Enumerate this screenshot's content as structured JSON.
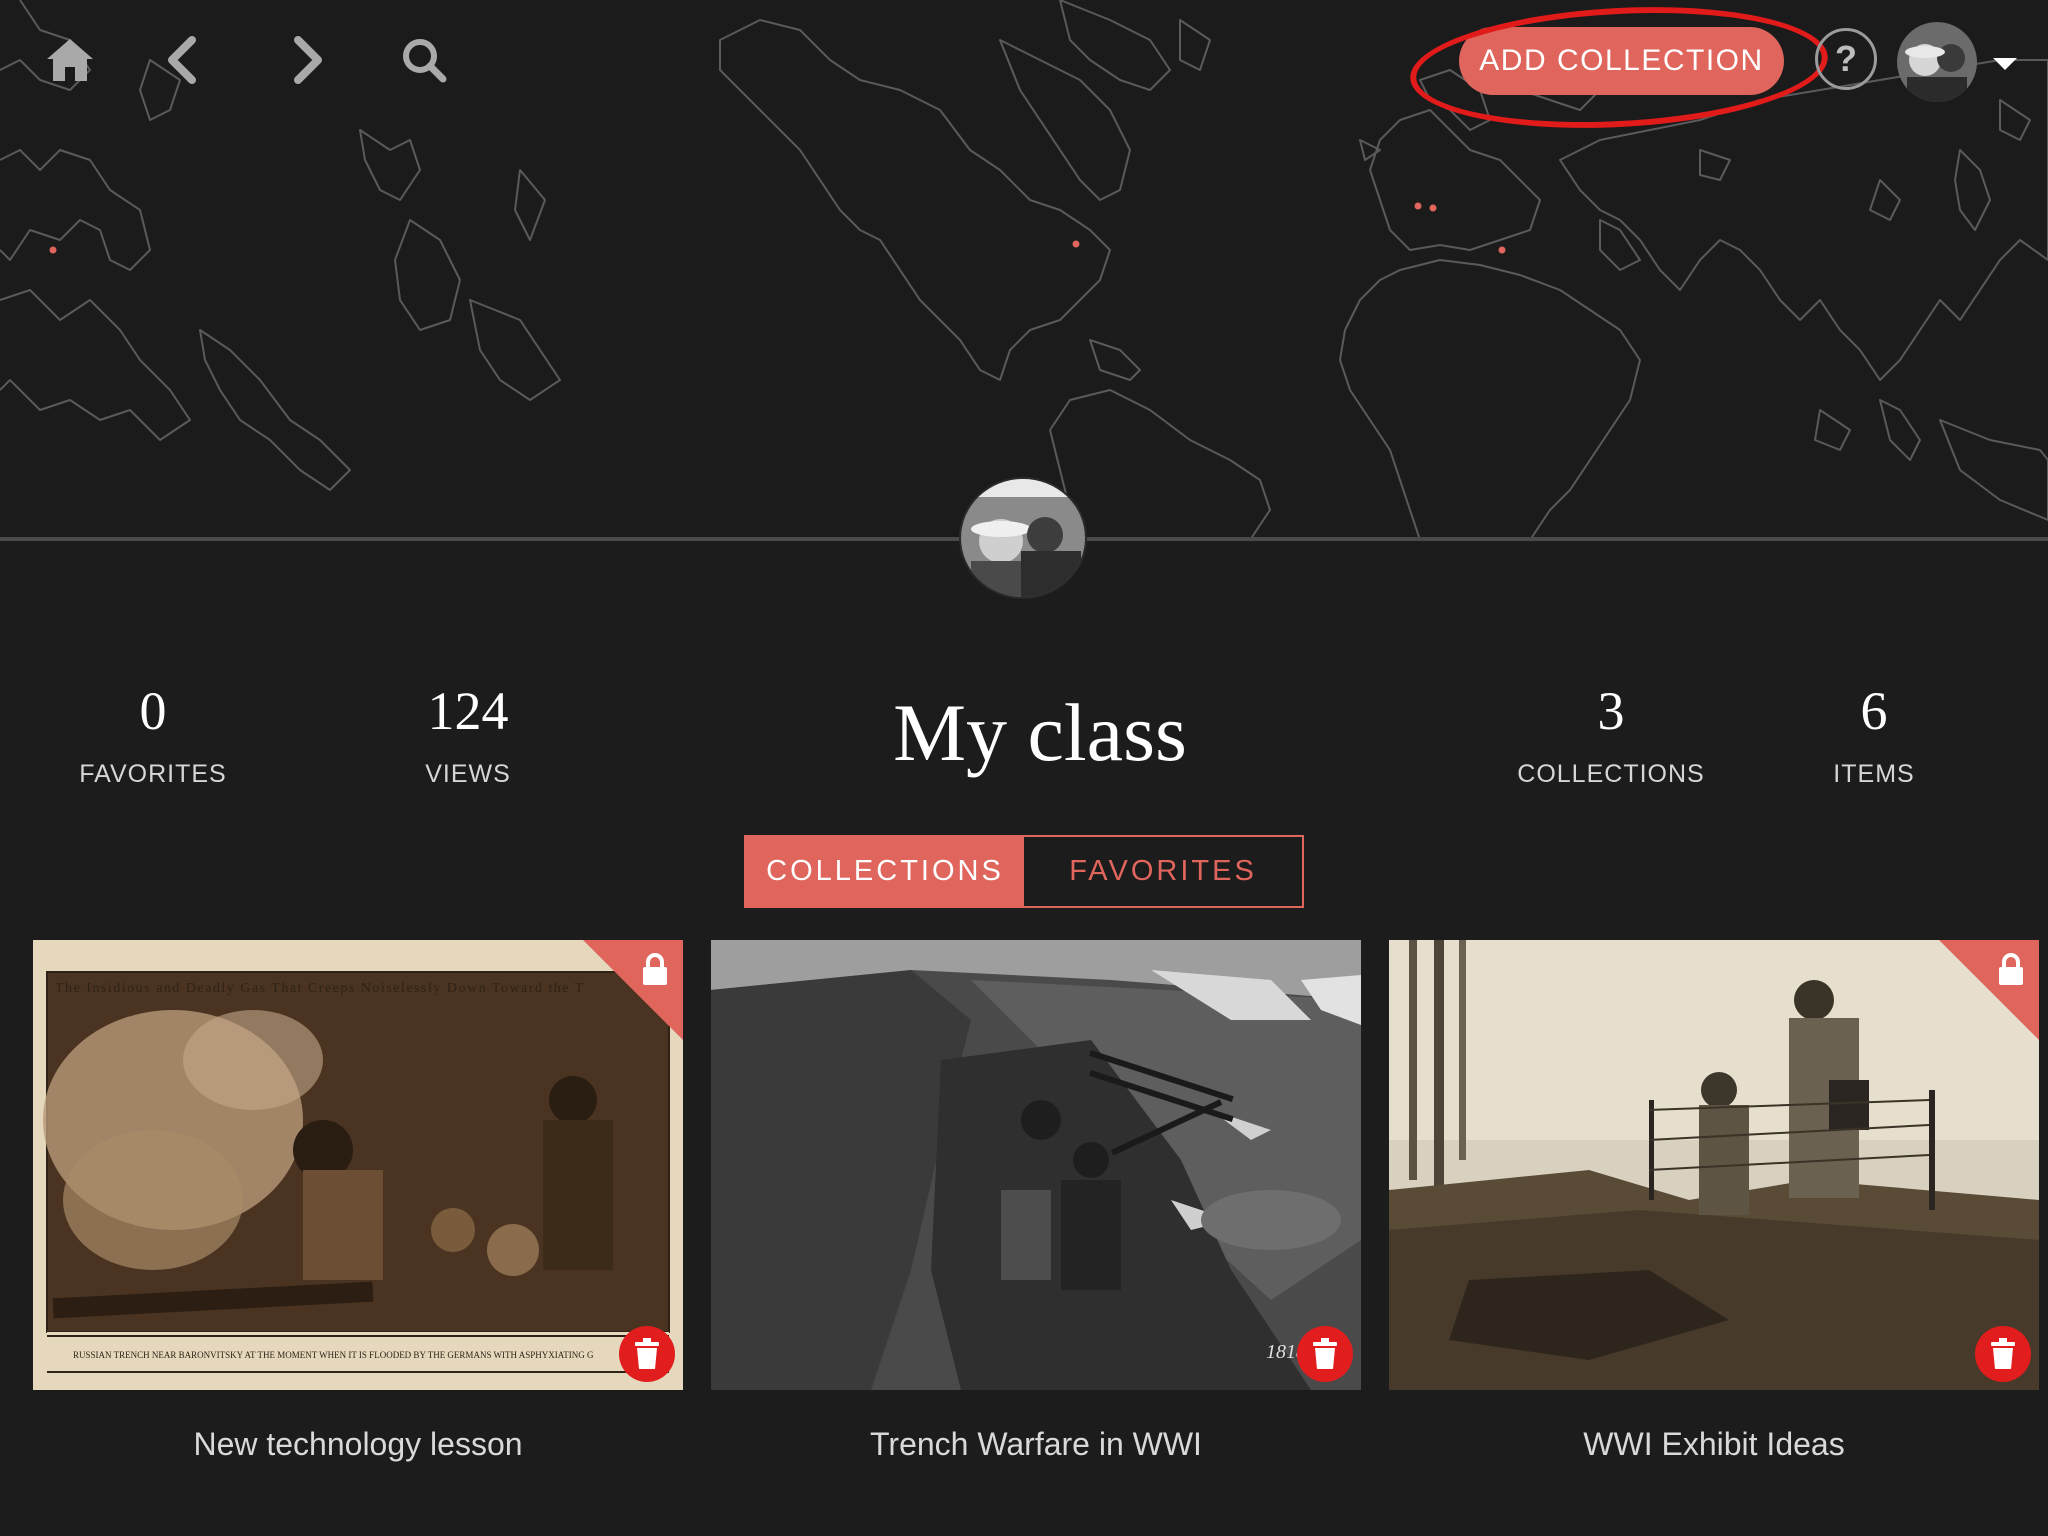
{
  "header": {
    "add_collection_label": "ADD COLLECTION",
    "help_label": "?",
    "map_dot_color": "#e0655c",
    "accent_color": "#e0655c"
  },
  "nav": {
    "icons": [
      "home-icon",
      "back-arrow-icon",
      "forward-arrow-icon",
      "search-icon"
    ]
  },
  "profile": {
    "title": "My class"
  },
  "stats": {
    "favorites": {
      "value": "0",
      "label": "FAVORITES"
    },
    "views": {
      "value": "124",
      "label": "VIEWS"
    },
    "collections": {
      "value": "3",
      "label": "COLLECTIONS"
    },
    "items": {
      "value": "6",
      "label": "ITEMS"
    }
  },
  "tabs": [
    {
      "label": "COLLECTIONS",
      "active": true
    },
    {
      "label": "FAVORITES",
      "active": false
    }
  ],
  "cards": [
    {
      "title": "New technology lesson",
      "locked": true,
      "caption_top": "The Insidious and Deadly Gas That Creeps Noiselessly Down Toward the T",
      "caption_bottom": "RUSSIAN TRENCH NEAR BARONVITSKY AT THE MOMENT WHEN IT IS FLOODED BY THE GERMANS WITH ASPHYXIATING G"
    },
    {
      "title": "Trench Warfare in WWI",
      "locked": false,
      "photo_mark": "1818"
    },
    {
      "title": "WWI Exhibit Ideas",
      "locked": true
    }
  ]
}
